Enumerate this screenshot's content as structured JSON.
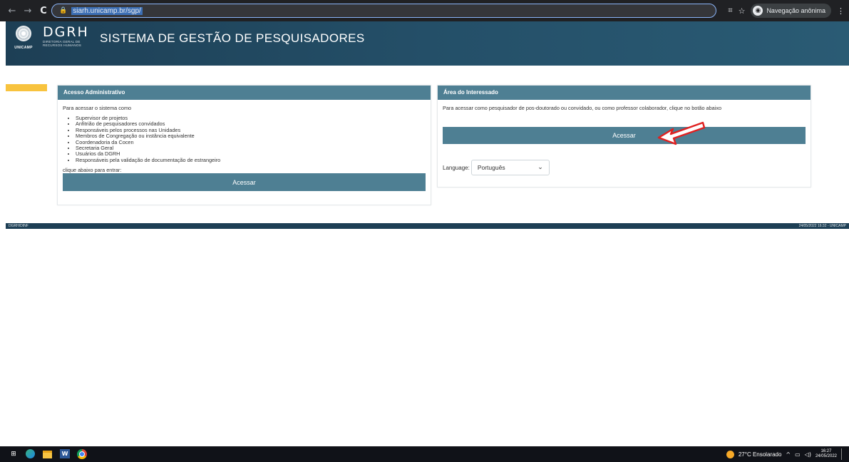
{
  "browser": {
    "back": "←",
    "forward": "→",
    "reload": "C",
    "lock": "🔒",
    "url": "siarh.unicamp.br/sgp/",
    "translate_icon": "⌗",
    "star_icon": "☆",
    "incognito_label": "Navegação anônima",
    "menu_icon": "⋮"
  },
  "header": {
    "unicamp_label": "UNICAMP",
    "dgrh_logo": "DGRH",
    "dgrh_sub_1": "DIRETORIA GERAL DE",
    "dgrh_sub_2": "RECURSOS HUMANOS",
    "system_title": "SISTEMA DE GESTÃO DE PESQUISADORES"
  },
  "admin_panel": {
    "title": "Acesso Administrativo",
    "intro": "Para acessar o sistema como",
    "roles": [
      "Supervisor de projetos",
      "Anfitrião de pesquisadores convidados",
      "Responsáveis pelos processos nas Unidades",
      "Membros de Congregação ou instância equivalente",
      "Coordenadoria da Cocen",
      "Secretaria Geral",
      "Usuários da DGRH",
      "Responsáveis pela validação de documentação de estrangeiro"
    ],
    "click_below": "clique abaixo para entrar:",
    "button_label": "Acessar"
  },
  "interested_panel": {
    "title": "Área do Interessado",
    "intro": "Para acessar como pesquisador de pos-doutorado ou convidado, ou como professor colaborador, clique no botão abaixo",
    "button_label": "Acessar",
    "language_label": "Language:",
    "language_value": "Português"
  },
  "footer": {
    "left": "DGRH/DINF",
    "right": "24/05/2022 16:32 - UNICAMP"
  },
  "taskbar": {
    "weather": "27°C  Ensolarado",
    "tray_arrow": "^",
    "time": "16:27",
    "date": "24/05/2022"
  },
  "colors": {
    "header_bg": "#1d3f55",
    "panel_header": "#4e7f93",
    "accent_yellow": "#f8c33e",
    "annotation_arrow": "#e02020"
  }
}
